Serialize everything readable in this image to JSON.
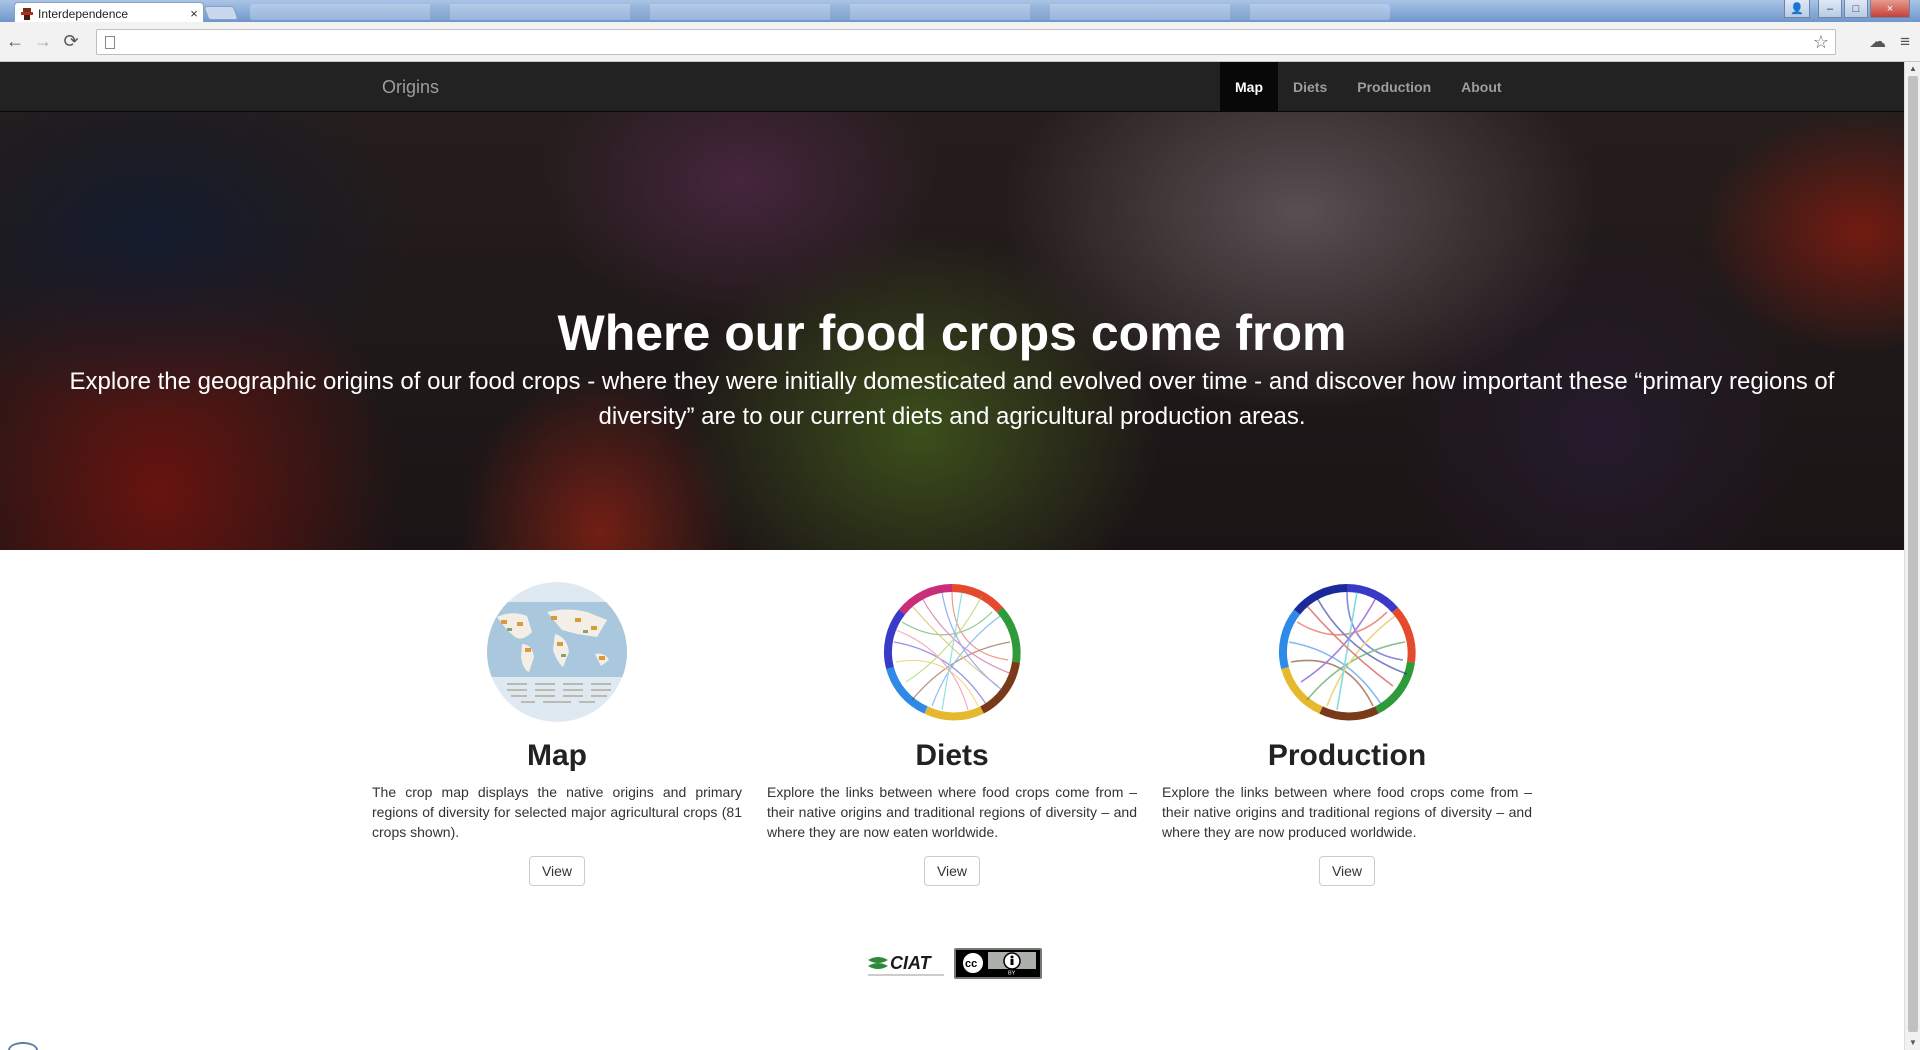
{
  "browser": {
    "tab_title": "Interdependence",
    "tab_close": "×",
    "url": "",
    "nav": {
      "back": "←",
      "forward": "→",
      "reload": "⟳"
    },
    "icons": {
      "star": "☆",
      "cloud": "☁",
      "menu": "≡"
    },
    "window_buttons": {
      "minimize": "–",
      "maximize": "□",
      "close": "×",
      "user": "👤"
    }
  },
  "navbar": {
    "brand": "Origins",
    "links": [
      {
        "label": "Map",
        "active": true
      },
      {
        "label": "Diets",
        "active": false
      },
      {
        "label": "Production",
        "active": false
      },
      {
        "label": "About",
        "active": false
      }
    ]
  },
  "hero": {
    "title": "Where our food crops come from",
    "subtitle": "Explore the geographic origins of our food crops - where they were initially domesticated and evolved over time - and discover how important these “primary regions of diversity” are to our current diets and agricultural production areas."
  },
  "features": [
    {
      "title": "Map",
      "description": "The crop map displays the native origins and primary regions of diversity for selected major agricultural crops (81 crops shown).",
      "button": "View",
      "thumb_icon": "world-map-icon"
    },
    {
      "title": "Diets",
      "description": "Explore the links between where food crops come from – their native origins and traditional regions of diversity – and where they are now eaten worldwide.",
      "button": "View",
      "thumb_icon": "chord-diagram-icon"
    },
    {
      "title": "Production",
      "description": "Explore the links between where food crops come from – their native origins and traditional regions of diversity – and where they are now produced worldwide.",
      "button": "View",
      "thumb_icon": "chord-diagram-icon"
    }
  ],
  "footer": {
    "ciat": "CIAT",
    "cc": "cc",
    "cc_by": "BY"
  },
  "colors": {
    "navbar_bg": "#222222",
    "navbar_active": "#080808",
    "navbar_text": "#9d9d9d"
  }
}
